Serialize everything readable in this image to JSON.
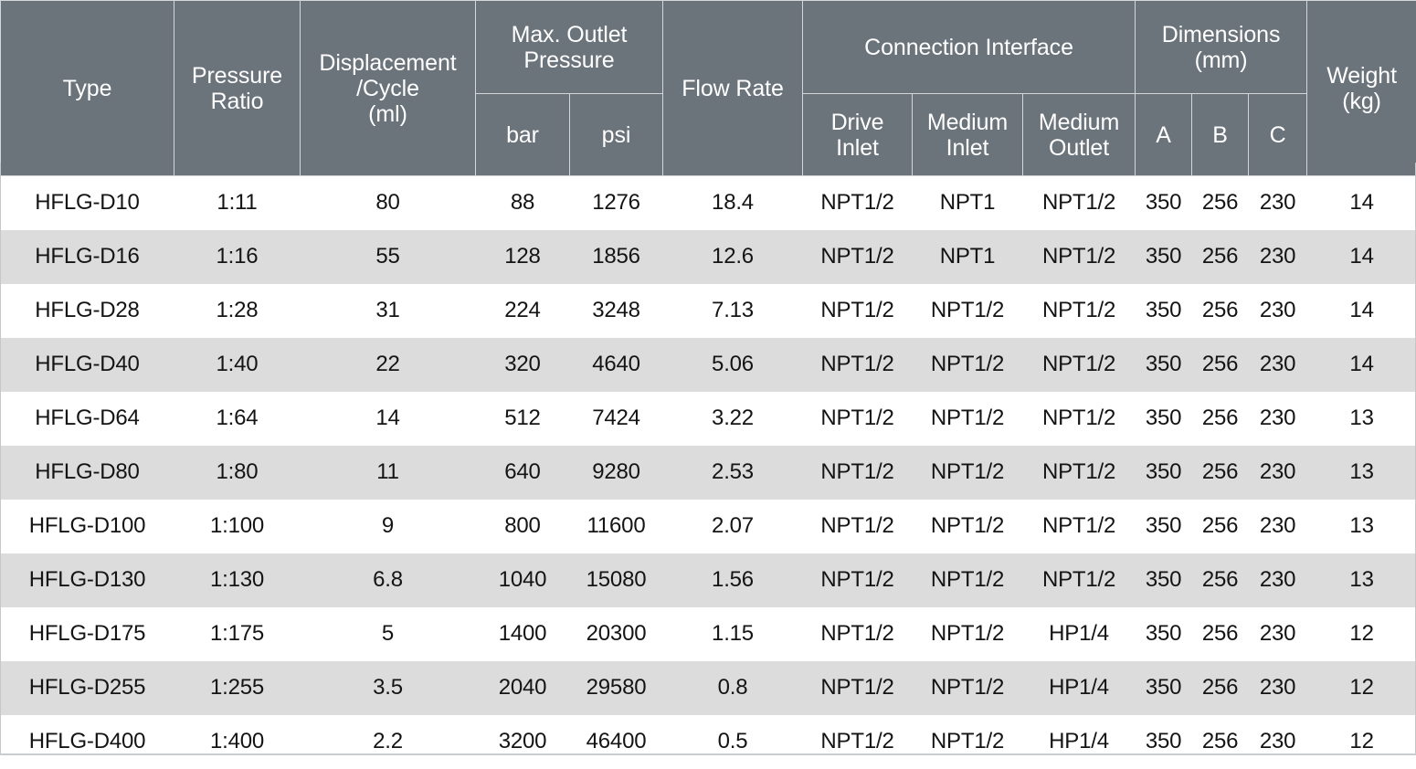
{
  "table": {
    "header": {
      "type": "Type",
      "pressure_ratio": "Pressure\nRatio",
      "displacement": "Displacement\n/Cycle\n(ml)",
      "max_outlet_pressure": "Max. Outlet\nPressure",
      "bar": "bar",
      "psi": "psi",
      "flow_rate": "Flow Rate",
      "connection_interface": "Connection Interface",
      "drive_inlet": "Drive\nInlet",
      "medium_inlet": "Medium\nInlet",
      "medium_outlet": "Medium\nOutlet",
      "dimensions": "Dimensions\n(mm)",
      "dim_a": "A",
      "dim_b": "B",
      "dim_c": "C",
      "weight": "Weight\n(kg)"
    },
    "rows": [
      {
        "type": "HFLG-D10",
        "pressure_ratio": "1:11",
        "displacement": "80",
        "bar": "88",
        "psi": "1276",
        "flow_rate": "18.4",
        "drive_inlet": "NPT1/2",
        "medium_inlet": "NPT1",
        "medium_outlet": "NPT1/2",
        "dim_a": "350",
        "dim_b": "256",
        "dim_c": "230",
        "weight": "14"
      },
      {
        "type": "HFLG-D16",
        "pressure_ratio": "1:16",
        "displacement": "55",
        "bar": "128",
        "psi": "1856",
        "flow_rate": "12.6",
        "drive_inlet": "NPT1/2",
        "medium_inlet": "NPT1",
        "medium_outlet": "NPT1/2",
        "dim_a": "350",
        "dim_b": "256",
        "dim_c": "230",
        "weight": "14"
      },
      {
        "type": "HFLG-D28",
        "pressure_ratio": "1:28",
        "displacement": "31",
        "bar": "224",
        "psi": "3248",
        "flow_rate": "7.13",
        "drive_inlet": "NPT1/2",
        "medium_inlet": "NPT1/2",
        "medium_outlet": "NPT1/2",
        "dim_a": "350",
        "dim_b": "256",
        "dim_c": "230",
        "weight": "14"
      },
      {
        "type": "HFLG-D40",
        "pressure_ratio": "1:40",
        "displacement": "22",
        "bar": "320",
        "psi": "4640",
        "flow_rate": "5.06",
        "drive_inlet": "NPT1/2",
        "medium_inlet": "NPT1/2",
        "medium_outlet": "NPT1/2",
        "dim_a": "350",
        "dim_b": "256",
        "dim_c": "230",
        "weight": "14"
      },
      {
        "type": "HFLG-D64",
        "pressure_ratio": "1:64",
        "displacement": "14",
        "bar": "512",
        "psi": "7424",
        "flow_rate": "3.22",
        "drive_inlet": "NPT1/2",
        "medium_inlet": "NPT1/2",
        "medium_outlet": "NPT1/2",
        "dim_a": "350",
        "dim_b": "256",
        "dim_c": "230",
        "weight": "13"
      },
      {
        "type": "HFLG-D80",
        "pressure_ratio": "1:80",
        "displacement": "11",
        "bar": "640",
        "psi": "9280",
        "flow_rate": "2.53",
        "drive_inlet": "NPT1/2",
        "medium_inlet": "NPT1/2",
        "medium_outlet": "NPT1/2",
        "dim_a": "350",
        "dim_b": "256",
        "dim_c": "230",
        "weight": "13"
      },
      {
        "type": "HFLG-D100",
        "pressure_ratio": "1:100",
        "displacement": "9",
        "bar": "800",
        "psi": "11600",
        "flow_rate": "2.07",
        "drive_inlet": "NPT1/2",
        "medium_inlet": "NPT1/2",
        "medium_outlet": "NPT1/2",
        "dim_a": "350",
        "dim_b": "256",
        "dim_c": "230",
        "weight": "13"
      },
      {
        "type": "HFLG-D130",
        "pressure_ratio": "1:130",
        "displacement": "6.8",
        "bar": "1040",
        "psi": "15080",
        "flow_rate": "1.56",
        "drive_inlet": "NPT1/2",
        "medium_inlet": "NPT1/2",
        "medium_outlet": "NPT1/2",
        "dim_a": "350",
        "dim_b": "256",
        "dim_c": "230",
        "weight": "13"
      },
      {
        "type": "HFLG-D175",
        "pressure_ratio": "1:175",
        "displacement": "5",
        "bar": "1400",
        "psi": "20300",
        "flow_rate": "1.15",
        "drive_inlet": "NPT1/2",
        "medium_inlet": "NPT1/2",
        "medium_outlet": "HP1/4",
        "dim_a": "350",
        "dim_b": "256",
        "dim_c": "230",
        "weight": "12"
      },
      {
        "type": "HFLG-D255",
        "pressure_ratio": "1:255",
        "displacement": "3.5",
        "bar": "2040",
        "psi": "29580",
        "flow_rate": "0.8",
        "drive_inlet": "NPT1/2",
        "medium_inlet": "NPT1/2",
        "medium_outlet": "HP1/4",
        "dim_a": "350",
        "dim_b": "256",
        "dim_c": "230",
        "weight": "12"
      },
      {
        "type": "HFLG-D400",
        "pressure_ratio": "1:400",
        "displacement": "2.2",
        "bar": "3200",
        "psi": "46400",
        "flow_rate": "0.5",
        "drive_inlet": "NPT1/2",
        "medium_inlet": "NPT1/2",
        "medium_outlet": "HP1/4",
        "dim_a": "350",
        "dim_b": "256",
        "dim_c": "230",
        "weight": "12"
      }
    ]
  },
  "colors": {
    "header_bg": "#6b737b",
    "header_text": "#ffffff",
    "row_odd_bg": "#ffffff",
    "row_even_bg": "#dcdcdc",
    "body_text": "#141414",
    "grid_line": "#d3d7da"
  }
}
